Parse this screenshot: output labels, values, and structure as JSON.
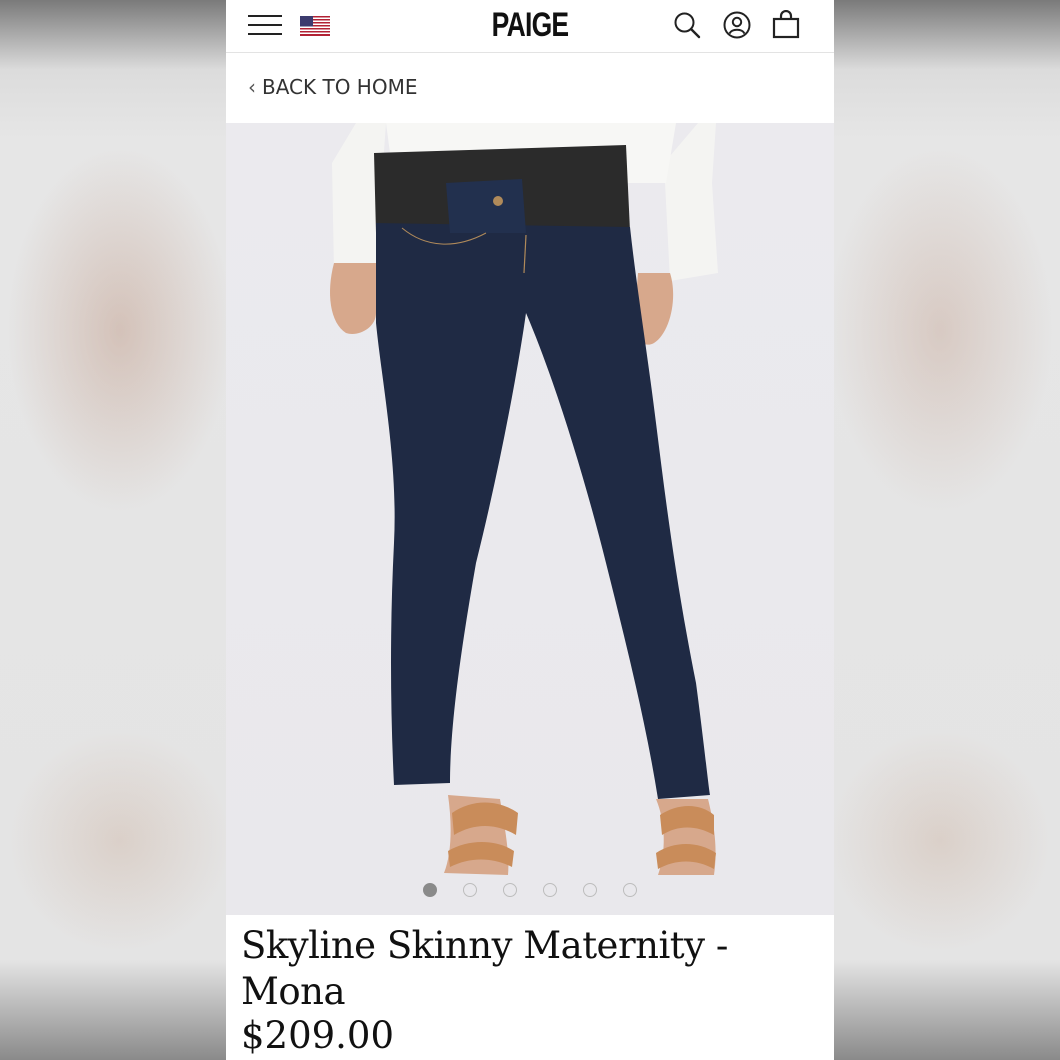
{
  "header": {
    "logo": "PAIGE",
    "menu_icon": "hamburger-menu-icon",
    "flag_icon": "us-flag-icon",
    "search_icon": "search-icon",
    "account_icon": "account-icon",
    "bag_icon": "shopping-bag-icon"
  },
  "nav": {
    "back_label": "BACK TO HOME",
    "back_icon": "chevron-left-icon"
  },
  "gallery": {
    "image_count": 6,
    "active_index": 0
  },
  "product": {
    "title": "Skyline Skinny Maternity - Mona",
    "price": "$209.00"
  },
  "colors": {
    "denim": "#1f2a44",
    "panel": "#2b2b2b",
    "shirt": "#f4f4f2",
    "sandal": "#c98c5a"
  }
}
